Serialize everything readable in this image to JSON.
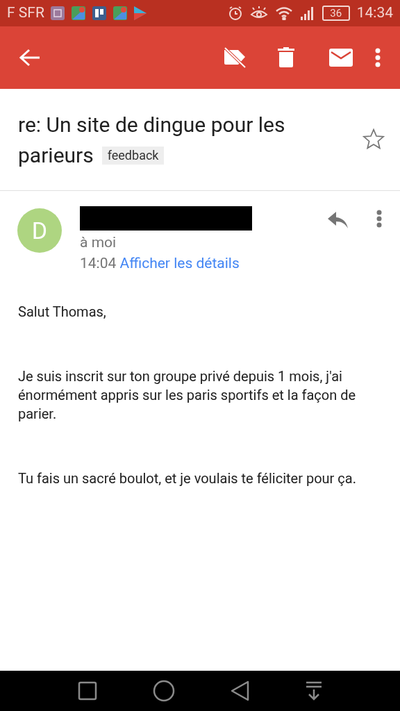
{
  "status_bar": {
    "carrier": "F SFR",
    "battery": "36",
    "time": "14:34"
  },
  "message": {
    "subject_lines": [
      "re: Un site de dingue pour les",
      "parieurs"
    ],
    "label": "feedback",
    "starred": false
  },
  "sender": {
    "initial": "D",
    "recipient": "à moi",
    "time": "14:04",
    "details_link": "Afficher les détails"
  },
  "body": [
    "Salut Thomas,",
    "Je suis inscrit sur ton groupe privé depuis 1 mois, j'ai énormément appris sur les paris sportifs et la façon de parier.",
    "Tu fais un sacré boulot, et je voulais te féliciter pour ça."
  ]
}
